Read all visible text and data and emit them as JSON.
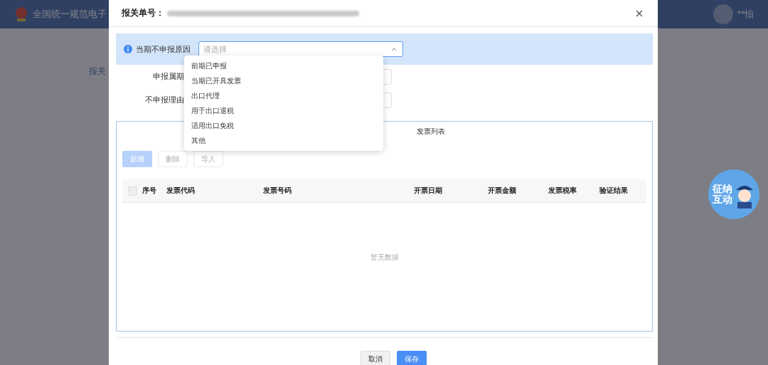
{
  "background": {
    "app_title": "全国统一规范电子",
    "user_name": "**怡",
    "tab": "报关"
  },
  "dialog": {
    "title_label": "报关单号：",
    "banner": {
      "label": "当期不申报原因",
      "placeholder": "请选择",
      "expanded": true
    },
    "form_rows": [
      {
        "label": "申报属期"
      },
      {
        "label": "不申报理由"
      }
    ],
    "dropdown_options": [
      "前期已申报",
      "当期已开具发票",
      "出口代理",
      "用于出口退税",
      "适用出口免税",
      "其他"
    ],
    "invoice_panel": {
      "title": "发票列表",
      "buttons": [
        {
          "label": "新增",
          "kind": "primary",
          "disabled": true
        },
        {
          "label": "删除",
          "kind": "default",
          "disabled": true
        },
        {
          "label": "导入",
          "kind": "default",
          "disabled": true
        }
      ],
      "table": {
        "select_all_checked": false,
        "columns": [
          "序号",
          "发票代码",
          "发票号码",
          "开票日期",
          "开票金额",
          "发票税率",
          "验证结果"
        ],
        "empty_text": "暂无数据"
      }
    },
    "footer_buttons": [
      {
        "label": "取消",
        "kind": "default"
      },
      {
        "label": "保存",
        "kind": "primary"
      }
    ]
  },
  "assistant_badge": {
    "text": "征纳互动"
  }
}
